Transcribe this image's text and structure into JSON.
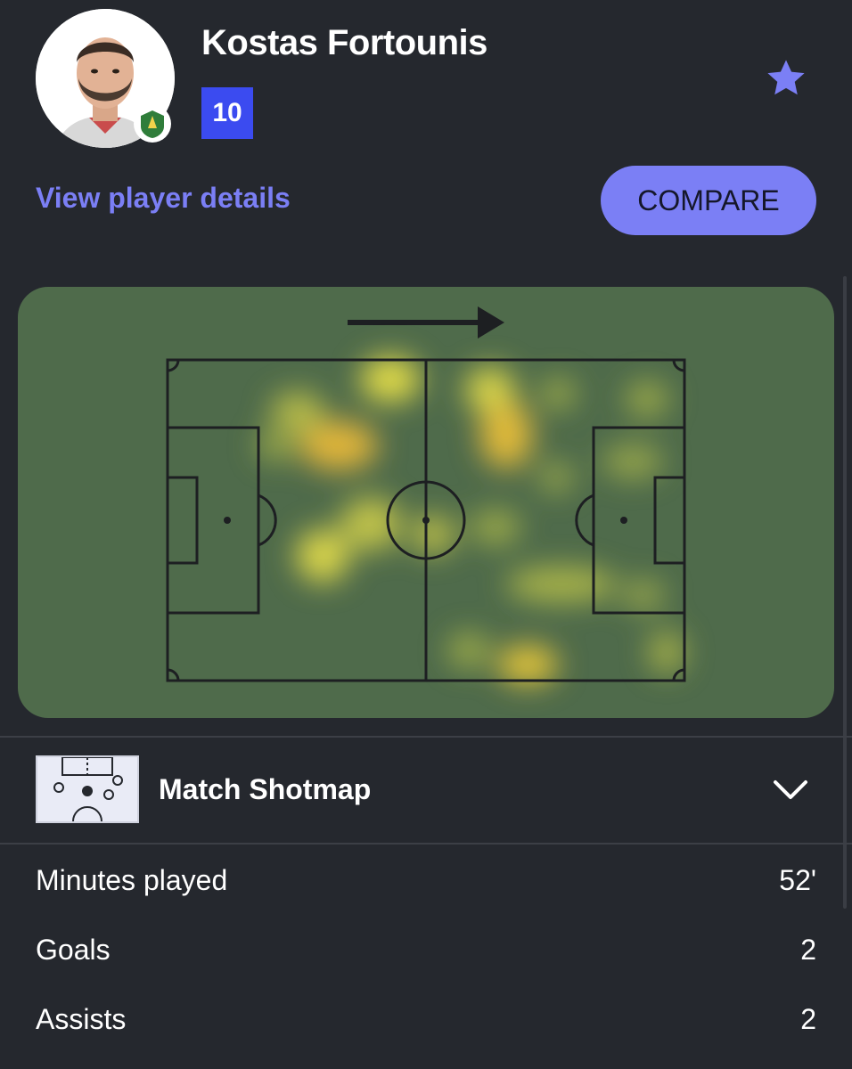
{
  "player": {
    "name": "Kostas Fortounis",
    "shirt_number": "10"
  },
  "actions": {
    "view_details_label": "View player details",
    "compare_label": "COMPARE"
  },
  "heatmap": {
    "direction": "attacking-right"
  },
  "shotmap": {
    "title": "Match Shotmap"
  },
  "stats": [
    {
      "label": "Minutes played",
      "value": "52'"
    },
    {
      "label": "Goals",
      "value": "2"
    },
    {
      "label": "Assists",
      "value": "2"
    }
  ],
  "colors": {
    "background": "#25282e",
    "accent": "#7b7ff5",
    "shirt_badge": "#3b4bf0",
    "pitch": "#4f6b4b"
  },
  "icons": [
    "star-icon",
    "chevron-down-icon",
    "team-crest-icon",
    "direction-arrow-icon"
  ]
}
